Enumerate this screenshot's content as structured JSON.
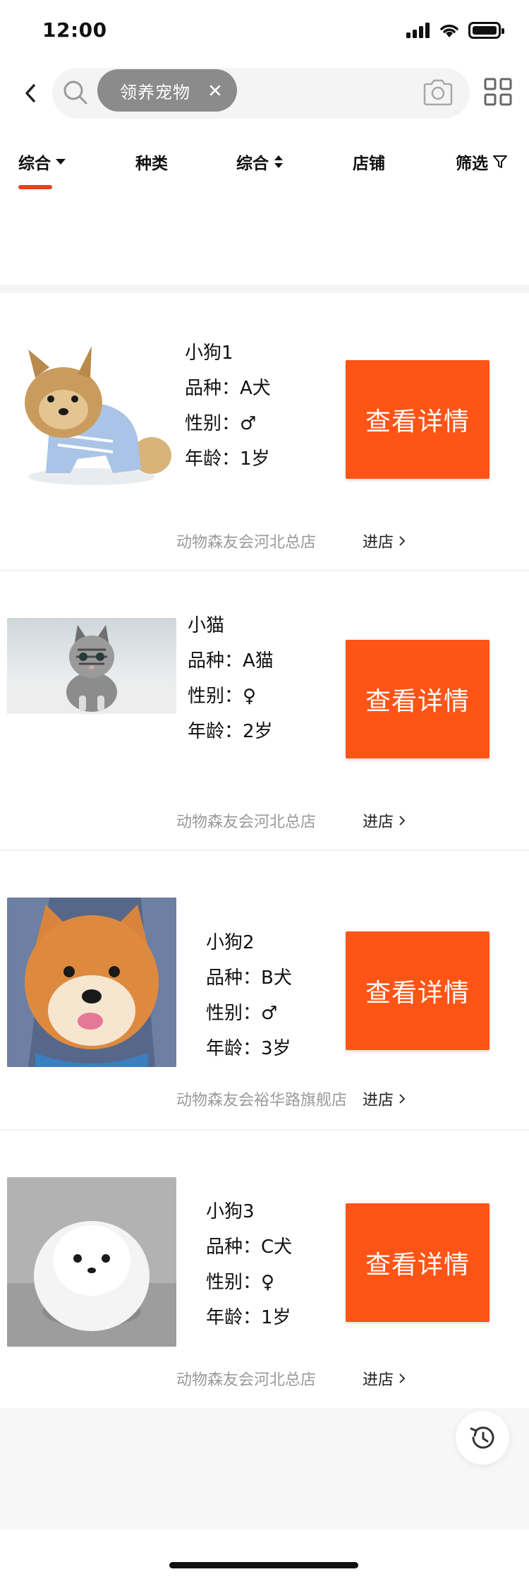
{
  "status_bar": {
    "time": "12:00"
  },
  "search": {
    "chip_text": "领养宠物"
  },
  "tabs": [
    {
      "label": "综合"
    },
    {
      "label": "种类"
    },
    {
      "label": "综合"
    },
    {
      "label": "店铺"
    },
    {
      "label": "筛选"
    }
  ],
  "pets": [
    {
      "name": "小狗1",
      "breed": "品种：A犬",
      "gender": "性别：♂",
      "age": "年龄：1岁",
      "button": "查看详情",
      "shop": "动物森友会河北总店",
      "enter": "进店"
    },
    {
      "name": "小猫",
      "breed": "品种：A猫",
      "gender": "性别：♀",
      "age": "年龄：2岁",
      "button": "查看详情",
      "shop": "动物森友会河北总店",
      "enter": "进店"
    },
    {
      "name": "小狗2",
      "breed": "品种：B犬",
      "gender": "性别：♂",
      "age": "年龄：3岁",
      "button": "查看详情",
      "shop": "动物森友会裕华路旗舰店",
      "enter": "进店"
    },
    {
      "name": "小狗3",
      "breed": "品种：C犬",
      "gender": "性别：♀",
      "age": "年龄：1岁",
      "button": "查看详情",
      "shop": "动物森友会河北总店",
      "enter": "进店"
    }
  ],
  "colors": {
    "accent": "#fe5416",
    "tab_underline": "#e8401b"
  }
}
